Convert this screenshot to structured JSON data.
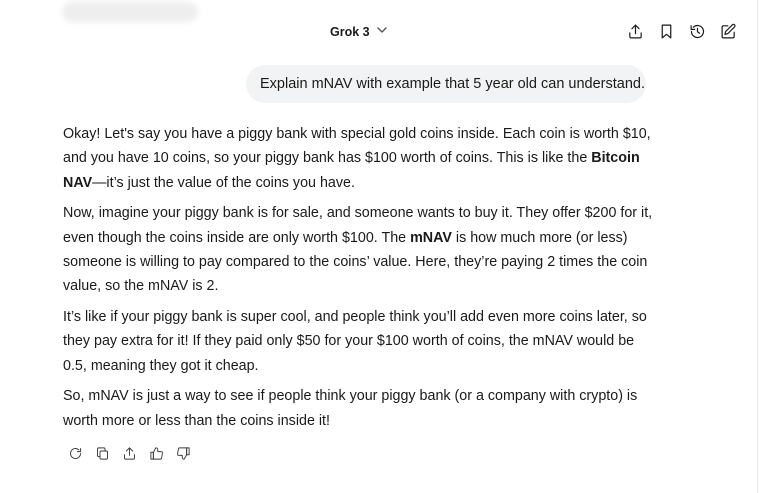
{
  "header": {
    "model_label": "Grok 3",
    "icons": [
      "share-icon",
      "bookmark-icon",
      "history-icon",
      "edit-icon"
    ]
  },
  "conversation": {
    "user_message": "Explain mNAV with example that 5 year old can understand.",
    "response": {
      "p1_a": "Okay! Let's say you have a piggy bank with special gold coins inside. Each coin is worth $10, and you have 10 coins, so your piggy bank has $100 worth of coins. This is like the ",
      "p1_bold": "Bitcoin NAV",
      "p1_b": "—it’s just the value of the coins you have.",
      "p2_a": "Now, imagine your piggy bank is for sale, and someone wants to buy it. They offer $200 for it, even though the coins inside are only worth $100. The ",
      "p2_bold": "mNAV",
      "p2_b": " is how much more (or less) someone is willing to pay compared to the coins’ value. Here, they’re paying 2 times the coin value, so the mNAV is 2.",
      "p3": "It’s like if your piggy bank is super cool, and people think you’ll add even more coins later, so they pay extra for it! If they paid only $50 for your $100 worth of coins, the mNAV would be 0.5, meaning they got it cheap.",
      "p4": "So, mNAV is just a way to see if people think your piggy bank (or a company with crypto) is worth more or less than the coins inside it!"
    }
  },
  "response_actions": [
    "regenerate-icon",
    "copy-icon",
    "share-icon",
    "thumbs-up-icon",
    "thumbs-down-icon"
  ]
}
